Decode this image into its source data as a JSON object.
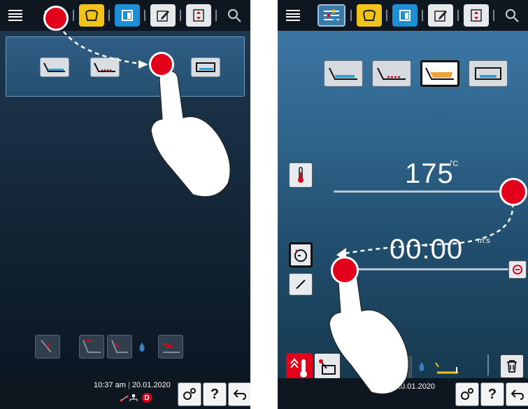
{
  "left_screen": {
    "status": {
      "time": "10:37 am",
      "date": "20.01.2020",
      "indicator": "D"
    },
    "gesture": "tap-and-drag"
  },
  "right_screen": {
    "temperature": {
      "value": "175",
      "unit": "°C"
    },
    "timer": {
      "value": "00:00",
      "unit": "m:s"
    },
    "status": {
      "date": "20.01.2020"
    },
    "selected_mode_index": 2
  },
  "status_buttons": {
    "help_label": "?"
  },
  "colors": {
    "accent_red": "#e2001a",
    "toolbar_yellow": "#f2c318",
    "toolbar_blue": "#1d8fd6"
  }
}
